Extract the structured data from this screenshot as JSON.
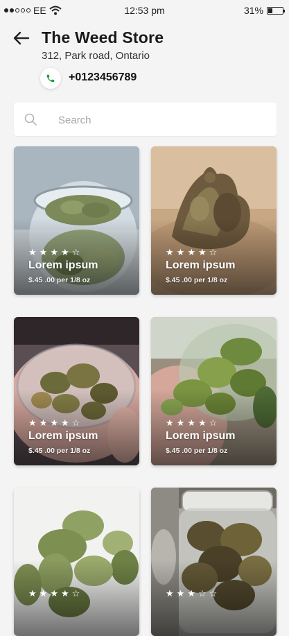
{
  "status_bar": {
    "carrier": "EE",
    "time": "12:53 pm",
    "battery": "31%",
    "battery_level": 0.31
  },
  "header": {
    "store_name": "The Weed Store",
    "address": "312, Park road, Ontario",
    "phone": "+0123456789"
  },
  "search": {
    "placeholder": "Search"
  },
  "colors": {
    "accent_phone": "#1e9a3a",
    "background": "#f4f4f4"
  },
  "products": [
    {
      "name": "Lorem ipsum",
      "price": "$.45 .00 per 1/8 oz",
      "rating": 4,
      "max_rating": 5,
      "theme": "jar-blue"
    },
    {
      "name": "Lorem ipsum",
      "price": "$.45 .00 per 1/8 oz",
      "rating": 4,
      "max_rating": 5,
      "theme": "bud-warm"
    },
    {
      "name": "Lorem ipsum",
      "price": "$.45 .00 per 1/8 oz",
      "rating": 4,
      "max_rating": 5,
      "theme": "bowl-hand"
    },
    {
      "name": "Lorem ipsum",
      "price": "$.45 .00 per 1/8 oz",
      "rating": 4,
      "max_rating": 5,
      "theme": "jar-hand"
    },
    {
      "name": "",
      "price": "",
      "rating": 4,
      "max_rating": 5,
      "theme": "buds-white"
    },
    {
      "name": "",
      "price": "",
      "rating": 3,
      "max_rating": 5,
      "theme": "jar-dark"
    }
  ]
}
